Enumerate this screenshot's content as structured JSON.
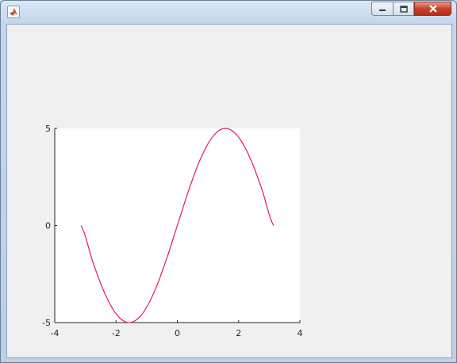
{
  "window": {
    "icon": "matlab-logo-icon",
    "controls": [
      "minimize-icon",
      "restore-icon",
      "close-icon"
    ],
    "close_color": "#c8412c"
  },
  "chart_data": {
    "type": "line",
    "title": "",
    "xlabel": "",
    "ylabel": "",
    "xlim": [
      -4,
      4
    ],
    "ylim": [
      -5,
      5
    ],
    "xticks": [
      -4,
      -2,
      0,
      2,
      4
    ],
    "yticks": [
      -5,
      0,
      5
    ],
    "grid": false,
    "series": [
      {
        "color": "#e8175d",
        "x": [
          -3.1416,
          -2.7489,
          -2.3562,
          -1.9635,
          -1.5708,
          -1.1781,
          -0.7854,
          -0.3927,
          0,
          0.3927,
          0.7854,
          1.1781,
          1.5708,
          1.9635,
          2.3562,
          2.7489,
          3.1416
        ],
        "y": [
          0,
          -1.913,
          -3.536,
          -4.619,
          -5,
          -4.619,
          -3.536,
          -1.913,
          0,
          1.913,
          3.536,
          4.619,
          5,
          4.619,
          3.536,
          1.913,
          0
        ]
      }
    ]
  }
}
